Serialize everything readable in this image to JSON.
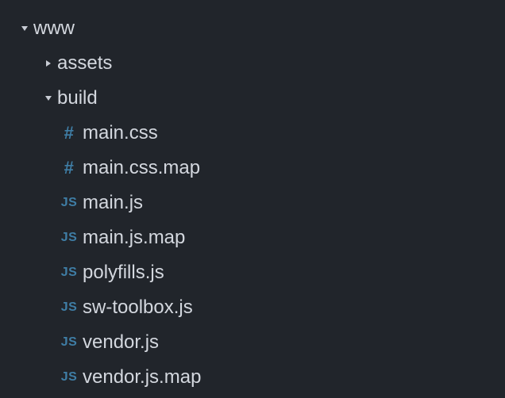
{
  "tree": {
    "root": {
      "label": "www",
      "children": {
        "assets": {
          "label": "assets"
        },
        "build": {
          "label": "build",
          "files": [
            {
              "icon": "#",
              "label": "main.css",
              "kind": "css"
            },
            {
              "icon": "#",
              "label": "main.css.map",
              "kind": "css"
            },
            {
              "icon": "JS",
              "label": "main.js",
              "kind": "js"
            },
            {
              "icon": "JS",
              "label": "main.js.map",
              "kind": "js"
            },
            {
              "icon": "JS",
              "label": "polyfills.js",
              "kind": "js"
            },
            {
              "icon": "JS",
              "label": "sw-toolbox.js",
              "kind": "js"
            },
            {
              "icon": "JS",
              "label": "vendor.js",
              "kind": "js"
            },
            {
              "icon": "JS",
              "label": "vendor.js.map",
              "kind": "js"
            }
          ]
        }
      }
    }
  }
}
